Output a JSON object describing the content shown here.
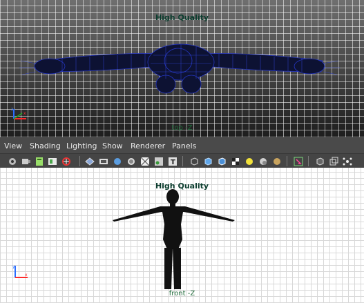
{
  "top_viewport": {
    "hud_label": "High Quality",
    "camera_label": "top -Z"
  },
  "menu": {
    "view": "View",
    "shading": "Shading",
    "lighting": "Lighting",
    "show": "Show",
    "renderer": "Renderer",
    "panels": "Panels"
  },
  "toolbar": {
    "icons": [
      "camera-select-icon",
      "camera-attributes-icon",
      "bookmark-icon",
      "image-plane-icon",
      "2d-pan-zoom-icon",
      "grease-pencil-icon",
      "grid-toggle-icon",
      "film-gate-icon",
      "resolution-gate-icon",
      "gate-mask-icon",
      "field-chart-icon",
      "safe-action-icon",
      "safe-title-icon",
      "wireframe-icon",
      "smooth-shade-icon",
      "shaded-wireframe-icon",
      "textured-icon",
      "default-light-icon",
      "shadows-icon",
      "ambient-occlusion-icon",
      "isolate-select-icon",
      "xray-icon",
      "xray-joints-icon",
      "xray-components-icon"
    ]
  },
  "bottom_viewport": {
    "hud_label": "High Quality",
    "camera_label": "front -Z"
  },
  "colors": {
    "top_mesh": "#0d1233",
    "top_wire": "#1f2eb0",
    "bottom_mesh": "#111111",
    "hud_text": "#0b3d2e"
  }
}
